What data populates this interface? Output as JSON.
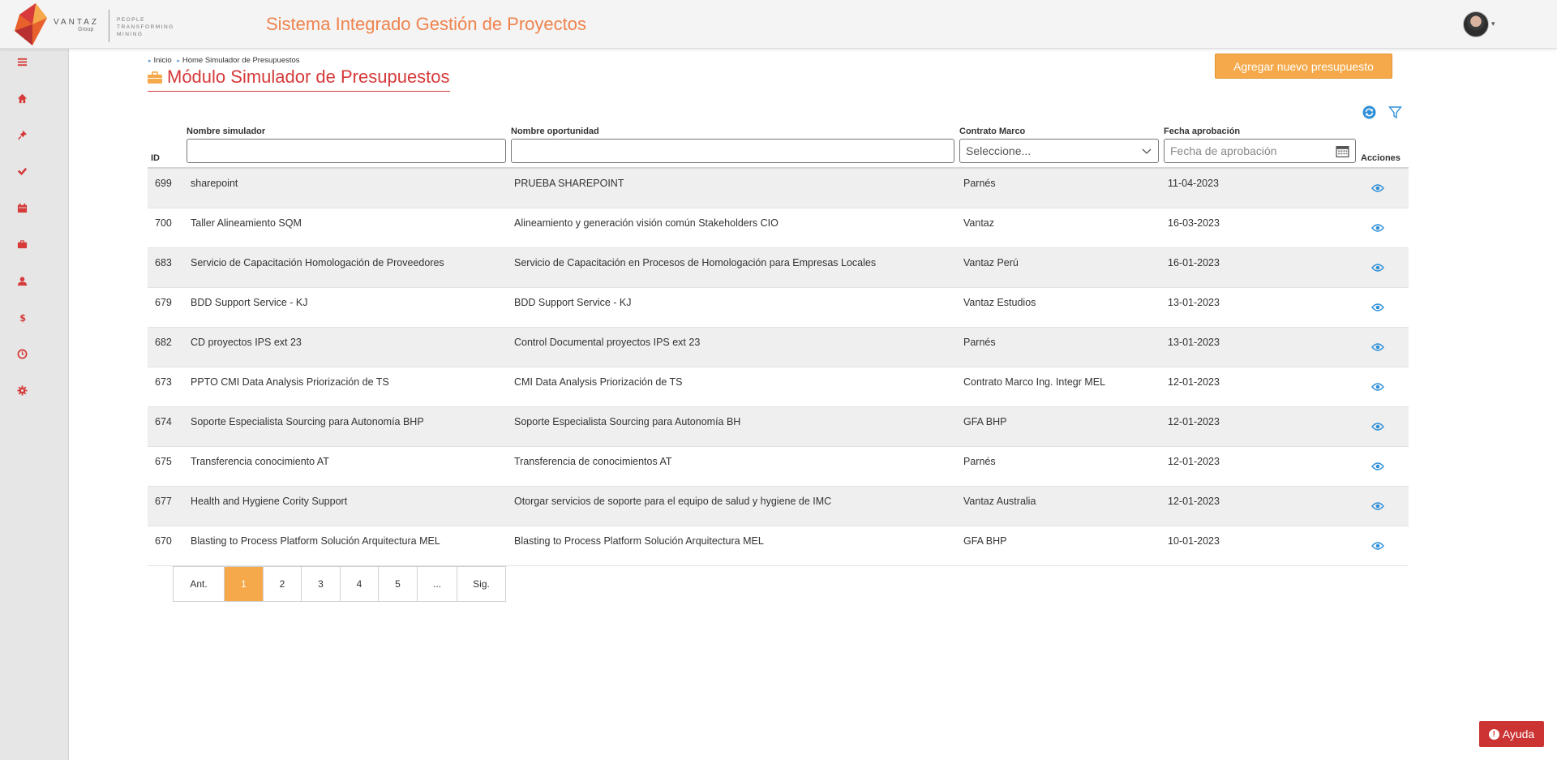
{
  "header": {
    "brand_name": "VANTAZ",
    "brand_group": "Group",
    "tagline_1": "PEOPLE",
    "tagline_2": "TRANSFORMING",
    "tagline_3": "MINING",
    "app_title": "Sistema Integrado Gestión de Proyectos"
  },
  "sidebar": {
    "items": [
      "menu-icon",
      "home-icon",
      "pin-icon",
      "check-icon",
      "calendar-icon",
      "briefcase-icon",
      "user-icon",
      "dollar-icon",
      "clock-icon",
      "gear-icon"
    ]
  },
  "breadcrumb": {
    "item1": "Inicio",
    "item2": "Home Simulador de Presupuestos"
  },
  "page": {
    "title": "Módulo Simulador de Presupuestos",
    "add_button": "Agregar nuevo presupuesto"
  },
  "table": {
    "headers": {
      "id": "ID",
      "simulador": "Nombre simulador",
      "oportunidad": "Nombre oportunidad",
      "contrato": "Contrato Marco",
      "fecha": "Fecha aprobación",
      "acciones": "Acciones"
    },
    "filters": {
      "simulador_value": "",
      "oportunidad_value": "",
      "contrato_selected": "Seleccione...",
      "fecha_placeholder": "Fecha de aprobación"
    },
    "rows": [
      {
        "id": "699",
        "simulador": "sharepoint",
        "oportunidad": "PRUEBA SHAREPOINT",
        "contrato": "Parnés",
        "fecha": "11-04-2023"
      },
      {
        "id": "700",
        "simulador": "Taller Alineamiento SQM",
        "oportunidad": "Alineamiento y generación visión común Stakeholders CIO",
        "contrato": "Vantaz",
        "fecha": "16-03-2023"
      },
      {
        "id": "683",
        "simulador": "Servicio de Capacitación Homologación de Proveedores",
        "oportunidad": "Servicio de Capacitación en Procesos de Homologación para Empresas Locales",
        "contrato": "Vantaz Perú",
        "fecha": "16-01-2023"
      },
      {
        "id": "679",
        "simulador": "BDD Support Service - KJ",
        "oportunidad": "BDD Support Service - KJ",
        "contrato": "Vantaz Estudios",
        "fecha": "13-01-2023"
      },
      {
        "id": "682",
        "simulador": "CD proyectos IPS ext 23",
        "oportunidad": "Control Documental proyectos IPS ext 23",
        "contrato": "Parnés",
        "fecha": "13-01-2023"
      },
      {
        "id": "673",
        "simulador": "PPTO CMI Data Analysis Priorización de TS",
        "oportunidad": "CMI Data Analysis Priorización de TS",
        "contrato": "Contrato Marco Ing. Integr MEL",
        "fecha": "12-01-2023"
      },
      {
        "id": "674",
        "simulador": "Soporte Especialista Sourcing para Autonomía BHP",
        "oportunidad": "Soporte Especialista Sourcing para Autonomía BH",
        "contrato": "GFA BHP",
        "fecha": "12-01-2023"
      },
      {
        "id": "675",
        "simulador": "Transferencia conocimiento AT",
        "oportunidad": "Transferencia de conocimientos AT",
        "contrato": "Parnés",
        "fecha": "12-01-2023"
      },
      {
        "id": "677",
        "simulador": "Health and Hygiene Cority Support",
        "oportunidad": "Otorgar servicios de soporte para el equipo de salud y hygiene de IMC",
        "contrato": "Vantaz Australia",
        "fecha": "12-01-2023"
      },
      {
        "id": "670",
        "simulador": "Blasting to Process Platform Solución Arquitectura MEL",
        "oportunidad": "Blasting to Process Platform Solución Arquitectura MEL",
        "contrato": "GFA BHP",
        "fecha": "10-01-2023"
      }
    ]
  },
  "pagination": {
    "prev": "Ant.",
    "pages": [
      "1",
      "2",
      "3",
      "4",
      "5",
      "..."
    ],
    "next": "Sig.",
    "current": "1"
  },
  "help": {
    "label": "Ayuda"
  },
  "colors": {
    "accent_orange": "#f5a94a",
    "title_red": "#d63a3a",
    "app_title_orange": "#f0834d",
    "icon_blue": "#2f8fd8"
  }
}
